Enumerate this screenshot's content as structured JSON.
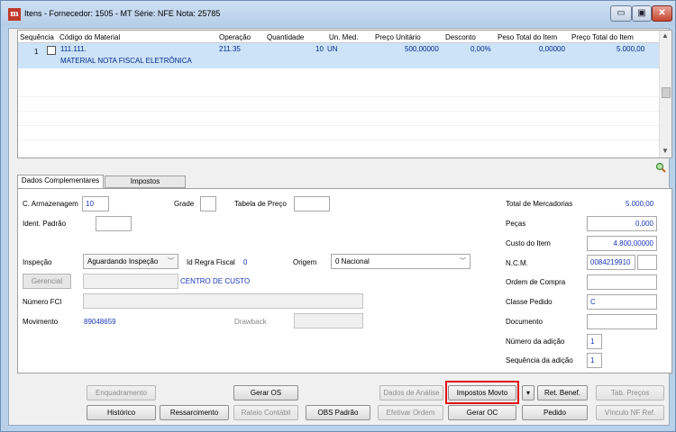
{
  "window": {
    "title": "Itens - Fornecedor: 1505 - MT Série: NFE  Nota: 25785",
    "icon": "app-logo-icon",
    "controls": {
      "minimize": "▭",
      "maximize": "▣",
      "close": "✕"
    }
  },
  "grid": {
    "columns": [
      "Sequência",
      "Código do Material",
      "Operação",
      "Quantidade",
      "Un. Med.",
      "Preço Unitário",
      "Desconto",
      "Peso Total do Item",
      "Preço Total do Item"
    ],
    "rows": [
      {
        "sequencia": "1",
        "codigo": "111.111.",
        "descricao": "MATERIAL NOTA FISCAL ELETRÔNICA",
        "operacao": "211.35",
        "quantidade": "10",
        "unidade": "UN",
        "preco_unitario": "500,00000",
        "desconto": "0,00%",
        "peso_total": "0,00000",
        "preco_total": "5.000,00"
      }
    ]
  },
  "tabs": [
    {
      "label": "Dados Complementares",
      "active": true
    },
    {
      "label": "Impostos",
      "active": false
    }
  ],
  "form": {
    "armazenagem": {
      "label": "C. Armazenagem",
      "value": "10"
    },
    "grade": {
      "label": "Grade",
      "value": ""
    },
    "tabela_preco": {
      "label": "Tabela de Preço",
      "value": ""
    },
    "ident_padrao": {
      "label": "Ident. Padrão",
      "value": ""
    },
    "inspecao": {
      "label": "Inspeção",
      "value": "Aguardando Inspeção"
    },
    "id_regra_fiscal": {
      "label": "Id Regra Fiscal",
      "value": "0"
    },
    "origem": {
      "label": "Origem",
      "value": "0 Nacional"
    },
    "gerencial": {
      "label": "Gerencial",
      "value": "",
      "centro_custo": "CENTRO DE CUSTO"
    },
    "numero_fci": {
      "label": "Número FCI",
      "value": ""
    },
    "movimento": {
      "label": "Movimento",
      "value": "89048659"
    },
    "drawback": {
      "label": "Drawback",
      "value": ""
    }
  },
  "totals": {
    "total_mercadorias": {
      "label": "Total de Mercadorias",
      "value": "5.000,00"
    },
    "pecas": {
      "label": "Peças",
      "value": "0,000"
    },
    "custo_item": {
      "label": "Custo do Item",
      "value": "4.800,00000"
    },
    "ncm": {
      "label": "N.C.M.",
      "value": "0084219910",
      "extra": ""
    },
    "ordem_compra": {
      "label": "Ordem de Compra",
      "value": ""
    },
    "classe_pedido": {
      "label": "Classe Pedido",
      "value": "C"
    },
    "documento": {
      "label": "Documento",
      "value": ""
    },
    "numero_adicao": {
      "label": "Número da adição",
      "value": "1"
    },
    "sequencia_adicao": {
      "label": "Sequência da adição",
      "value": "1"
    }
  },
  "buttons": {
    "enquadramento": "Enquadramento",
    "gerar_os": "Gerar OS",
    "dados_analise": "Dados de Análise",
    "impostos_movto": "Impostos Movto",
    "impostos_dropdown": "▾",
    "ret_benef": "Ret. Benef.",
    "tab_precos": "Tab. Preços",
    "historico": "Histórico",
    "ressarcimento": "Ressarcimento",
    "rateio_contabil": "Rateio Contábil",
    "obs_padrao": "OBS Padrão",
    "efetivar_ordem": "Efetivar Ordem",
    "gerar_oc": "Gerar OC",
    "pedido": "Pedido",
    "vinculo_nf_ref": "Vínculo NF Ref."
  },
  "colors": {
    "selected_row": "#cde3f7",
    "value_text": "#1a37b8",
    "highlight_border": "#e0101a"
  }
}
